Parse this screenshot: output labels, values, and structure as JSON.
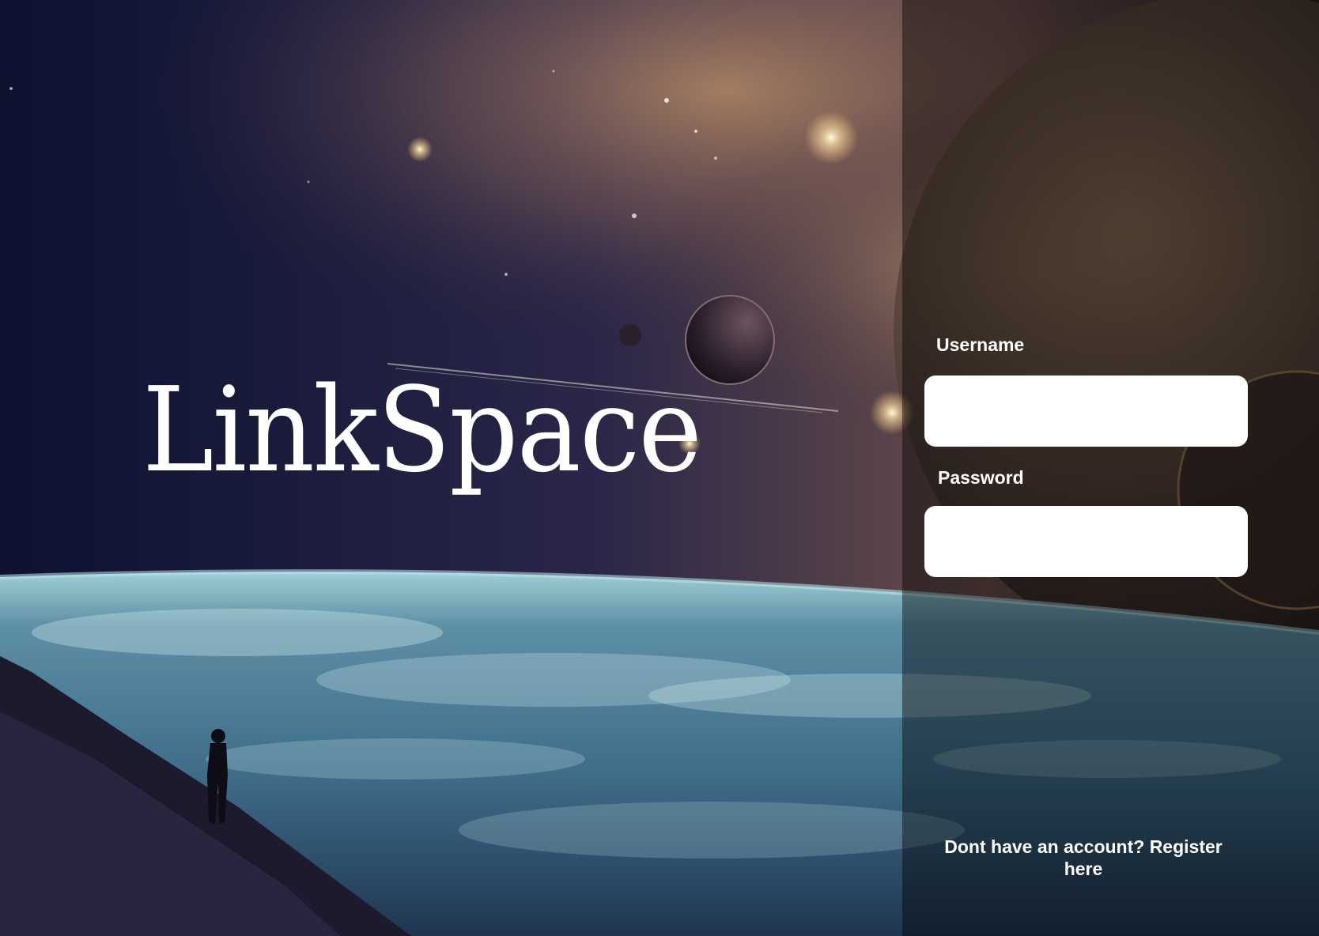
{
  "brand": {
    "title": "LinkSpace"
  },
  "login": {
    "username_label": "Username",
    "username_value": "",
    "password_label": "Password",
    "password_value": "",
    "register_text": "Dont have an account? Register here"
  },
  "icons": {
    "background": "space-landscape-image",
    "astronaut": "astronaut-silhouette-icon",
    "planet": "planet-icon"
  },
  "colors": {
    "panel_overlay": "rgba(0,0,0,0.42)",
    "text": "#ffffff",
    "input_bg": "#ffffff",
    "space_dark": "#0b1024",
    "nebula": "#a0765a",
    "earth": "#6fa8bd"
  }
}
